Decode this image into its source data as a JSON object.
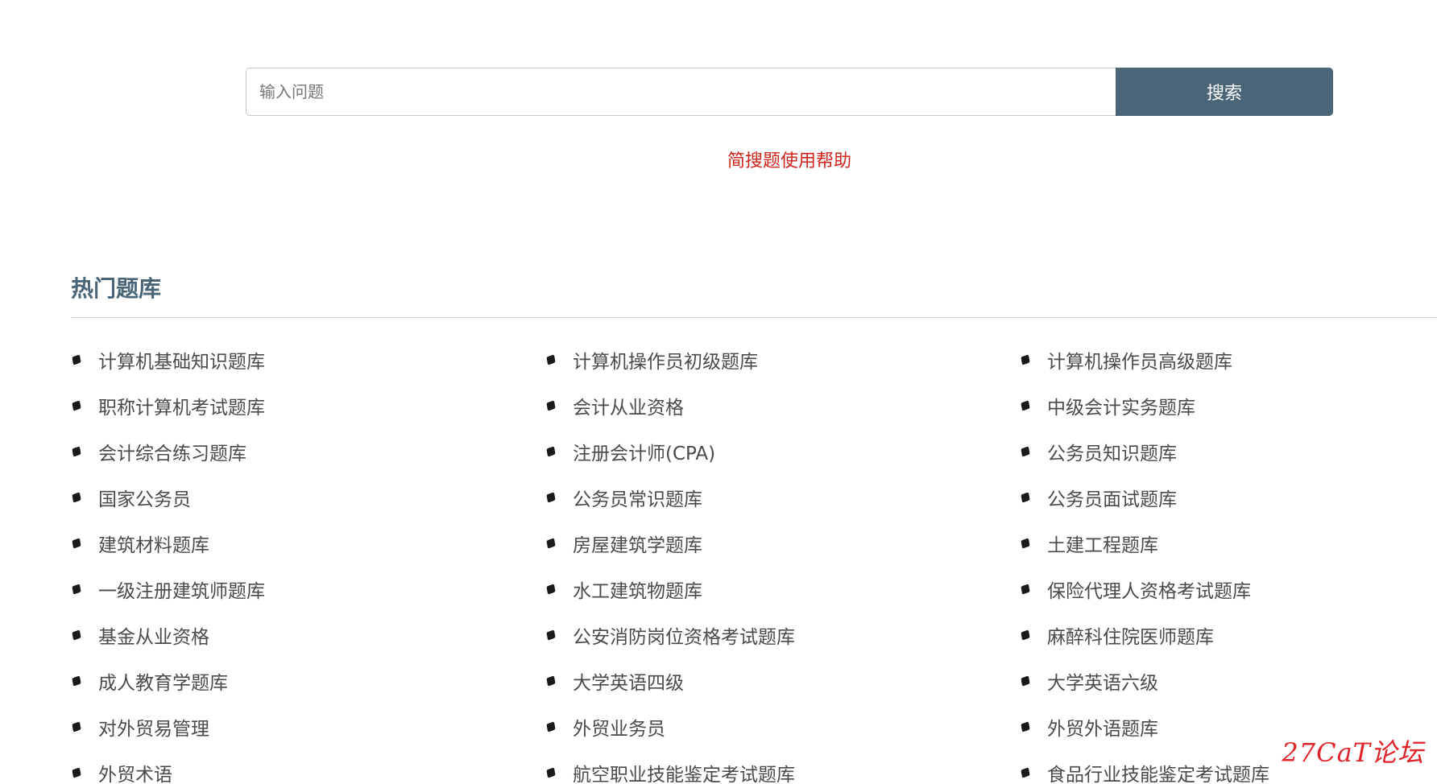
{
  "search": {
    "placeholder": "输入问题",
    "value": "",
    "button_label": "搜索"
  },
  "help_link": "简搜题使用帮助",
  "section": {
    "title": "热门题库"
  },
  "items": [
    "计算机基础知识题库",
    "计算机操作员初级题库",
    "计算机操作员高级题库",
    "职称计算机考试题库",
    "会计从业资格",
    "中级会计实务题库",
    "会计综合练习题库",
    "注册会计师(CPA)",
    "公务员知识题库",
    "国家公务员",
    "公务员常识题库",
    "公务员面试题库",
    "建筑材料题库",
    "房屋建筑学题库",
    "土建工程题库",
    "一级注册建筑师题库",
    "水工建筑物题库",
    "保险代理人资格考试题库",
    "基金从业资格",
    "公安消防岗位资格考试题库",
    "麻醉科住院医师题库",
    "成人教育学题库",
    "大学英语四级",
    "大学英语六级",
    "对外贸易管理",
    "外贸业务员",
    "外贸外语题库",
    "外贸术语",
    "航空职业技能鉴定考试题库",
    "食品行业技能鉴定考试题库"
  ],
  "watermark": "27CaT论坛",
  "colors": {
    "accent": "#4a6578",
    "help_link": "#d0231b",
    "watermark": "#e0242a"
  }
}
